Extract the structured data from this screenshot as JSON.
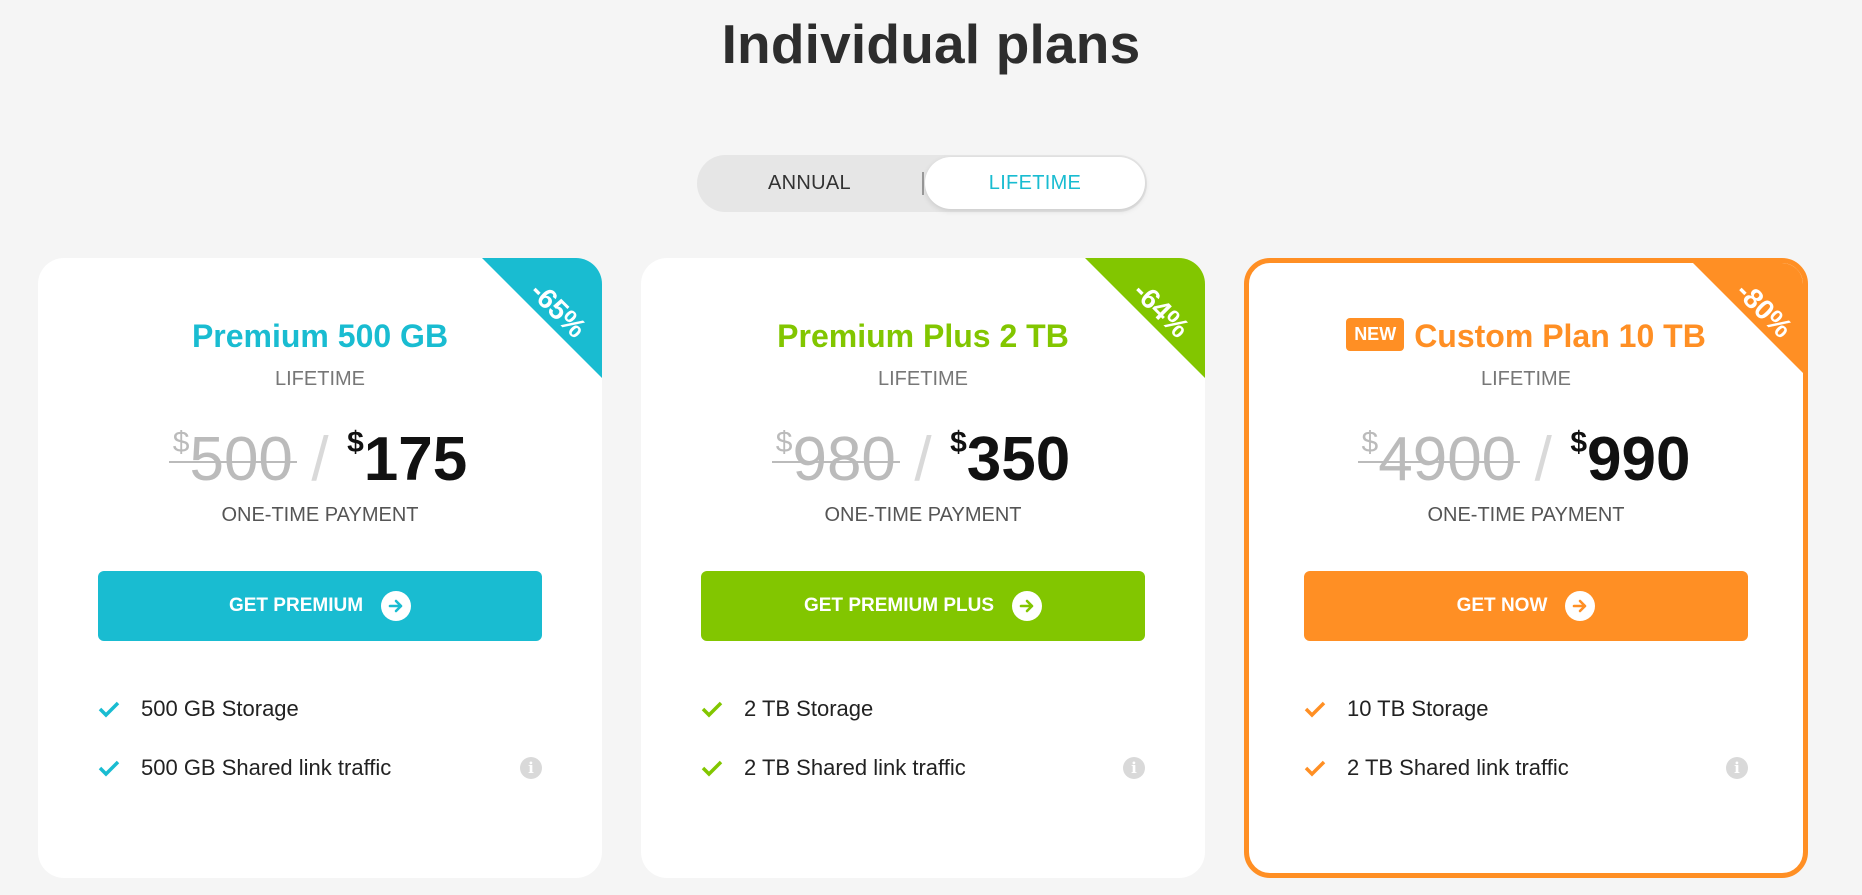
{
  "page_title": "Individual plans",
  "billing_toggle": {
    "annual": "ANNUAL",
    "lifetime": "LIFETIME",
    "selected": "LIFETIME"
  },
  "colors": {
    "teal": "#19bcd1",
    "green": "#82c600",
    "orange": "#ff8f24"
  },
  "plans": [
    {
      "title": "Premium 500 GB",
      "period": "LIFETIME",
      "discount": "-65%",
      "currency": "$",
      "old_price": "500",
      "separator": "/",
      "new_price": "175",
      "payment_note": "ONE-TIME PAYMENT",
      "cta": "GET PREMIUM",
      "features": [
        "500 GB Storage",
        "500 GB Shared link traffic"
      ]
    },
    {
      "title": "Premium Plus 2 TB",
      "period": "LIFETIME",
      "discount": "-64%",
      "currency": "$",
      "old_price": "980",
      "separator": "/",
      "new_price": "350",
      "payment_note": "ONE-TIME PAYMENT",
      "cta": "GET PREMIUM PLUS",
      "features": [
        "2 TB Storage",
        "2 TB Shared link traffic"
      ]
    },
    {
      "badge": "NEW",
      "title": "Custom Plan 10 TB",
      "period": "LIFETIME",
      "discount": "-80%",
      "currency": "$",
      "old_price": "4900",
      "separator": "/",
      "new_price": "990",
      "payment_note": "ONE-TIME PAYMENT",
      "cta": "GET NOW",
      "features": [
        "10 TB Storage",
        "2 TB Shared link traffic"
      ]
    }
  ],
  "info_icon_glyph": "i"
}
